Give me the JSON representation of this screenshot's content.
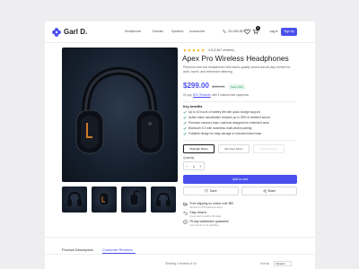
{
  "header": {
    "brand": "Garl D.",
    "nav": [
      "Headphones",
      "Earbuds",
      "Speakers",
      "Accessories"
    ],
    "phone": "321-555-987",
    "cart_count": "1",
    "login_label": "Log in",
    "signup_label": "Sign Up"
  },
  "product": {
    "rating_text": "4.8 (2,847 reviews)",
    "stars": 5,
    "title": "Apex Pro Wireless Headphones",
    "description": "Premium over-ear headphones with studio-quality sound and all-day comfort for work, travel, and immersive listening.",
    "price": "$299.00",
    "old_price": "$349.00",
    "save_badge": "Save 15%",
    "installments_prefix": "Or pay",
    "installments_amount": "$74.75/month",
    "installments_suffix": "with 4 interest-free payments",
    "benefits_title": "Key benefits",
    "benefits": [
      "Up to 40 hours of battery life with quick charge support",
      "Active noise cancellation reduces up to 35% of ambient sound",
      "Premium memory foam cushions designed for extended wear",
      "Bluetooth 5.3 with seamless multi-device pairing",
      "Foldable design for easy storage in included travel case"
    ],
    "colors": [
      "Midnight Black",
      "Brushed Silver",
      "Forest Green"
    ],
    "quantity_label": "Quantity",
    "quantity": "1",
    "add_to_cart_label": "Add to cart",
    "save_label": "Save",
    "share_label": "Share",
    "shipping": [
      {
        "title": "Free shipping on orders over $50",
        "sub": "Arrives in 3-5 business days"
      },
      {
        "title": "Easy returns",
        "sub": "Free returns within 30 days"
      },
      {
        "title": "Fit-day satisfaction guarantee",
        "sub": "Full refund if not satisfied"
      }
    ]
  },
  "tabs": {
    "description_label": "Product Description",
    "reviews_label": "Customer Reviews"
  },
  "reviews": {
    "showing": "Showing 3 reviews of 16",
    "sort_label": "Sort by",
    "sort_value": "Newest"
  },
  "colors": {
    "accent": "#4a4fee",
    "star": "#f5b31c",
    "check": "#2f9a5e"
  }
}
